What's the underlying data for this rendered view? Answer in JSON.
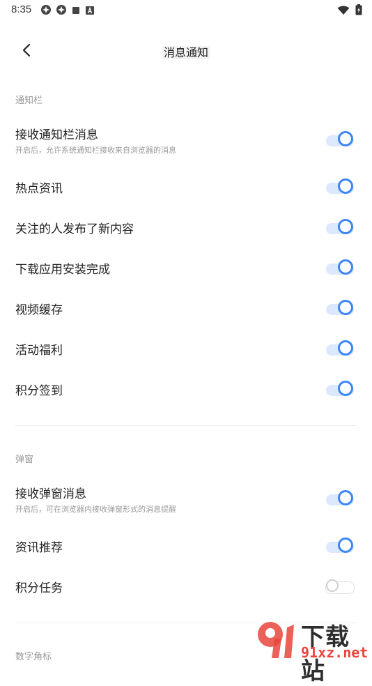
{
  "status_bar": {
    "time": "8:35",
    "left_icons": [
      "notification-app-icon",
      "notification-app-icon",
      "square-notification-icon",
      "font-notification-icon"
    ],
    "right_icons": [
      "wifi-icon",
      "battery-charging-icon"
    ]
  },
  "header": {
    "back_icon": "chevron-left-icon",
    "title": "消息通知"
  },
  "sections": [
    {
      "label": "通知栏",
      "items": [
        {
          "title": "接收通知栏消息",
          "desc": "开启后，允许系统通知栏接收来自浏览器的消息",
          "enabled": true
        },
        {
          "title": "热点资讯",
          "enabled": true
        },
        {
          "title": "关注的人发布了新内容",
          "enabled": true
        },
        {
          "title": "下载应用安装完成",
          "enabled": true
        },
        {
          "title": "视频缓存",
          "enabled": true
        },
        {
          "title": "活动福利",
          "enabled": true
        },
        {
          "title": "积分签到",
          "enabled": true
        }
      ]
    },
    {
      "label": "弹窗",
      "items": [
        {
          "title": "接收弹窗消息",
          "desc": "开启后，可在浏览器内接收弹窗形式的消息提醒",
          "enabled": true
        },
        {
          "title": "资讯推荐",
          "enabled": true
        },
        {
          "title": "积分任务",
          "enabled": false
        }
      ]
    },
    {
      "label": "数字角标",
      "items": []
    }
  ],
  "watermark": {
    "logo_text": "9",
    "title": "下载站",
    "url": "91xz.net"
  },
  "colors": {
    "accent": "#3c86f7",
    "toggle_track_on": "#dbe8fd",
    "section_label": "#999999",
    "watermark_red": "#e8453c"
  }
}
